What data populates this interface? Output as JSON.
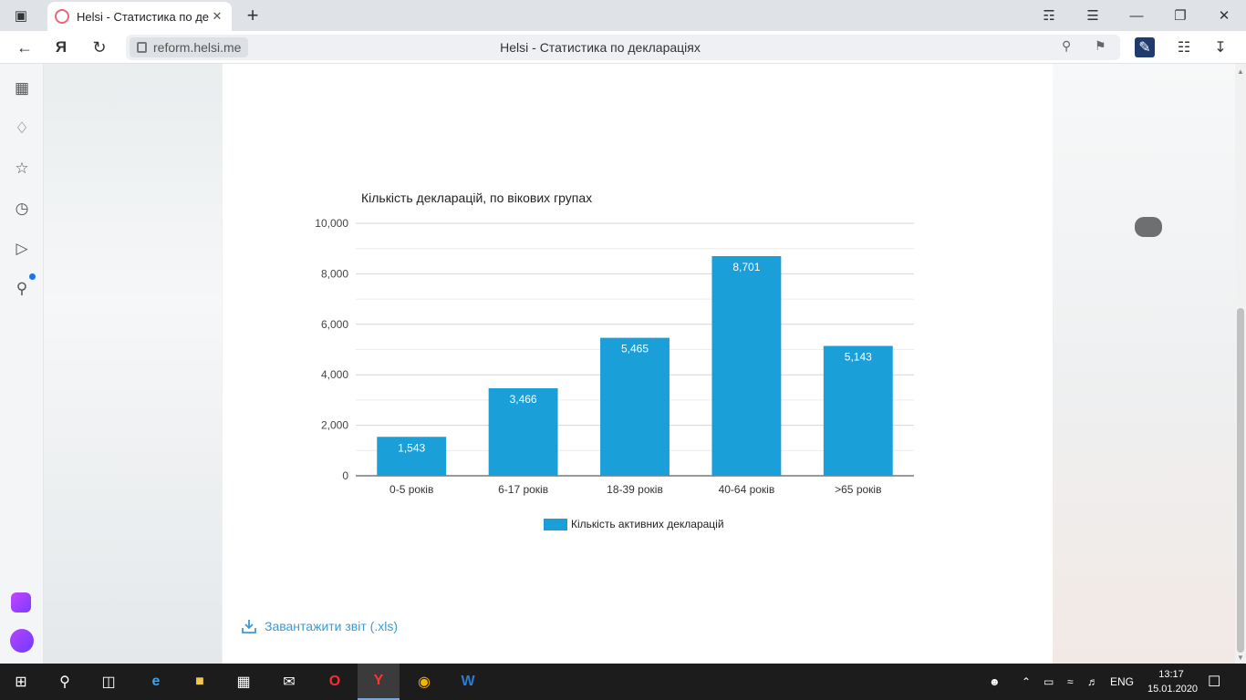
{
  "browser": {
    "tab_title": "Helsi - Статистика по де",
    "domain": "reform.helsi.me",
    "page_title": "Helsi - Статистика по деклараціях",
    "yandex_label": "Я"
  },
  "chart_data": {
    "type": "bar",
    "title": "Кількість декларацій, по вікових групах",
    "categories": [
      "0-5 років",
      "6-17 років",
      "18-39 років",
      "40-64 років",
      ">65 років"
    ],
    "series": [
      {
        "name": "Кількість активних декларацій",
        "values": [
          1543,
          3466,
          5465,
          8701,
          5143
        ],
        "labels": [
          "1,543",
          "3,466",
          "5,465",
          "8,701",
          "5,143"
        ]
      }
    ],
    "ylim": [
      0,
      10000
    ],
    "y_ticks": [
      "0",
      "2,000",
      "4,000",
      "6,000",
      "8,000",
      "10,000"
    ],
    "color": "#1a9fd9",
    "legend_position": "bottom",
    "grid": true
  },
  "download": {
    "label": "Завантажити звіт (.xls)"
  },
  "taskbar": {
    "lang": "ENG",
    "time": "13:17",
    "date": "15.01.2020"
  }
}
